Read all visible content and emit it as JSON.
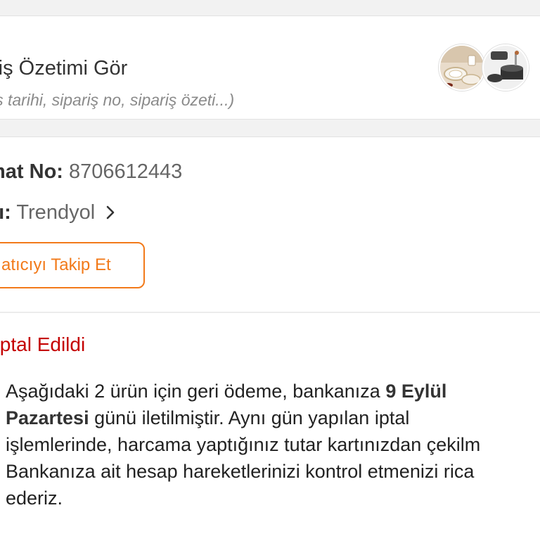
{
  "summary": {
    "title": "riş Özetimi Gör",
    "subtitle": "iş tarihi, sipariş no, sipariş özeti...)",
    "thumbnails": [
      "tableware-product-thumbnail",
      "cookware-product-thumbnail"
    ]
  },
  "order": {
    "teslimat_label": "mat No:",
    "teslimat_value": "8706612443",
    "satici_label": "cı:",
    "satici_value": "Trendyol",
    "follow_button": "atıcıyı Takip Et",
    "status": "İptal Edildi"
  },
  "refund_message": {
    "line1_pre": "Aşağıdaki 2 ürün için geri ödeme, bankanıza ",
    "line1_bold": "9 Eylül",
    "line2_bold": "Pazartesi",
    "line2_post": " günü iletilmiştir. Aynı gün yapılan iptal",
    "line3": "işlemlerinde, harcama yaptığınız tutar kartınızdan çekilm",
    "line4": "Bankanıza ait hesap hareketlerinizi kontrol etmenizi rica",
    "line5": "ederiz."
  },
  "colors": {
    "accent_orange": "#f27a1a",
    "status_red": "#c40000"
  }
}
